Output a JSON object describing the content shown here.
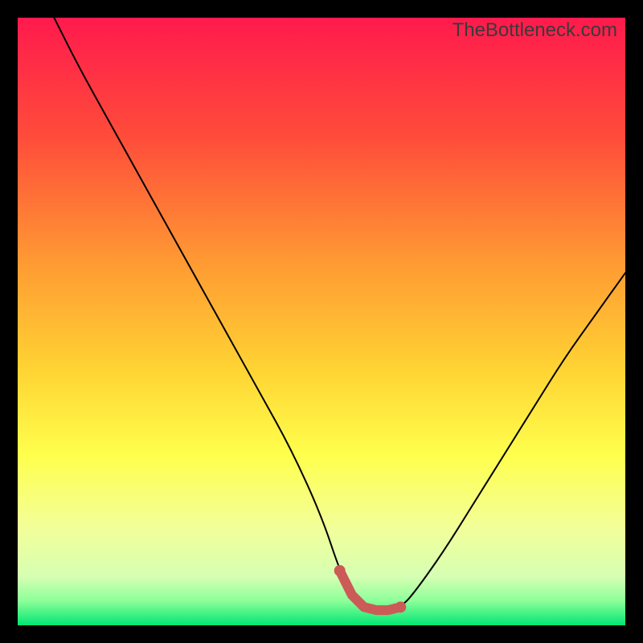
{
  "watermark": "TheBottleneck.com",
  "chart_data": {
    "type": "line",
    "title": "",
    "xlabel": "",
    "ylabel": "",
    "xlim": [
      0,
      100
    ],
    "ylim": [
      0,
      100
    ],
    "x": [
      6,
      10,
      15,
      20,
      25,
      30,
      35,
      40,
      45,
      50,
      53,
      55,
      57,
      59,
      61,
      63,
      65,
      70,
      75,
      80,
      85,
      90,
      95,
      100
    ],
    "values": [
      100,
      92,
      83,
      74,
      65,
      56,
      47,
      38,
      29,
      18,
      9,
      5,
      3,
      2.5,
      2.5,
      3,
      5,
      12,
      20,
      28,
      36,
      44,
      51,
      58
    ],
    "series_note": "V-shaped bottleneck curve; minimum (optimal match) around x≈58–62 at y≈2–3; left arm steeper than right.",
    "highlight_segment": {
      "x_start": 53,
      "x_end": 63,
      "note": "thick salmon/red segment marking optimal zone near curve bottom"
    },
    "background_gradient_stops": [
      {
        "pos": 0.0,
        "color": "#ff1a4d"
      },
      {
        "pos": 0.2,
        "color": "#ff4d3a"
      },
      {
        "pos": 0.4,
        "color": "#ff9933"
      },
      {
        "pos": 0.58,
        "color": "#ffd433"
      },
      {
        "pos": 0.72,
        "color": "#ffff4d"
      },
      {
        "pos": 0.84,
        "color": "#f2ff99"
      },
      {
        "pos": 0.92,
        "color": "#d6ffb3"
      },
      {
        "pos": 0.96,
        "color": "#8cff99"
      },
      {
        "pos": 1.0,
        "color": "#00e673"
      }
    ]
  }
}
